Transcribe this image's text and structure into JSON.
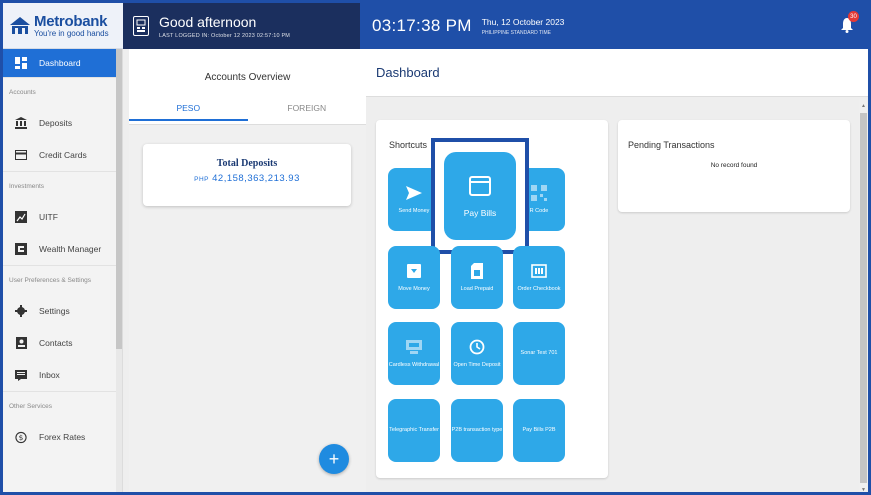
{
  "brand": {
    "name": "Metrobank",
    "tagline": "You're in good hands"
  },
  "greeting": {
    "title": "Good afternoon",
    "last_logged": "LAST LOGGED IN: October 12 2023 02:57:10 PM"
  },
  "clock": {
    "time": "03:17:38 PM",
    "date": "Thu, 12 October 2023",
    "timezone": "PHILIPPINE STANDARD TIME"
  },
  "notifications": {
    "count": "30",
    "icon": "bell-icon"
  },
  "sidebar": {
    "dashboard": "Dashboard",
    "section_accounts": "Accounts",
    "deposits": "Deposits",
    "credit_cards": "Credit Cards",
    "section_investments": "Investments",
    "uitf": "UITF",
    "wealth_manager": "Wealth Manager",
    "section_preferences": "User Preferences & Settings",
    "settings": "Settings",
    "contacts": "Contacts",
    "inbox": "Inbox",
    "section_other": "Other Services",
    "forex_rates": "Forex Rates"
  },
  "accounts_overview": {
    "title": "Accounts Overview",
    "tab_peso": "PESO",
    "tab_foreign": "FOREIGN",
    "total_deposits_label": "Total Deposits",
    "currency": "PHP",
    "total_deposits_amount": "42,158,363,213.93",
    "add_label": "+"
  },
  "dashboard": {
    "title": "Dashboard",
    "shortcuts_title": "Shortcuts",
    "pending_title": "Pending Transactions",
    "pending_empty": "No record found",
    "shortcuts": {
      "send_money": "Send Money",
      "pay_bills": "Pay Bills",
      "qr_code": "R Code",
      "move_money": "Move Money",
      "load_prepaid": "Load Prepaid",
      "order_checkbook": "Order Checkbook",
      "cardless_withdrawal": "Cardless Withdrawal",
      "open_time_deposit": "Open Time Deposit",
      "sonar_test": "Sonar Test 701",
      "telegraphic_transfer": "Telegraphic Transfer",
      "p2b_transaction": "P2B transaction type",
      "pay_bills_p2b": "Pay Bills P2B"
    }
  },
  "colors": {
    "primary": "#1f4fa8",
    "header_dark": "#1b2f5e",
    "tile": "#2ea8e8",
    "active": "#1f6fd6"
  }
}
